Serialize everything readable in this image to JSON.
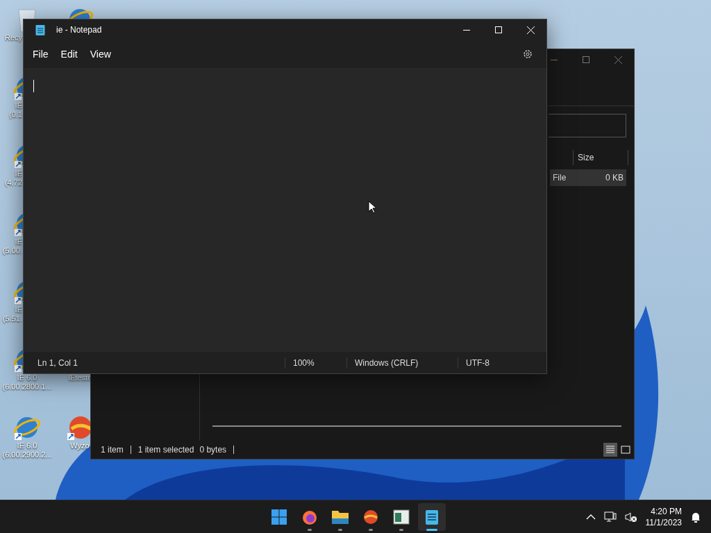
{
  "desktop": {
    "icons": [
      {
        "kind": "recycle",
        "lines": [
          "Recy"
        ]
      },
      {
        "kind": "ie",
        "lines": [
          "IE",
          "(0.1"
        ]
      },
      {
        "kind": "ie",
        "lines": [
          "IE",
          "(4.72"
        ]
      },
      {
        "kind": "ie",
        "lines": [
          "IE",
          "(5.00."
        ]
      },
      {
        "kind": "ie",
        "lines": [
          "IE",
          "(5.51."
        ]
      },
      {
        "kind": "ie",
        "lines": [
          "IE 6.0",
          "(6.00.2800.1..."
        ]
      },
      {
        "kind": "ie",
        "lines": [
          "IE 6.0",
          "(6.00.2900.2..."
        ]
      }
    ],
    "icons_right": [
      {
        "kind": "ie"
      },
      {
        "kind": "tester",
        "lines": [
          "IEteste"
        ]
      },
      {
        "kind": "wyzo",
        "lines": [
          "Wyzo"
        ]
      }
    ]
  },
  "explorer": {
    "column_header": "Size",
    "row": {
      "type": "File",
      "size": "0 KB",
      "selected": true
    },
    "status_items": "1 item",
    "status_selected": "1 item selected",
    "status_size": "0 bytes",
    "views": [
      {
        "kind": "details",
        "selected": true
      },
      {
        "kind": "tiles",
        "selected": false
      }
    ]
  },
  "notepad": {
    "title": "ie - Notepad",
    "menu": [
      "File",
      "Edit",
      "View"
    ],
    "status": {
      "position": "Ln 1, Col 1",
      "zoom": "100%",
      "line_ending": "Windows (CRLF)",
      "encoding": "UTF-8"
    }
  },
  "taskbar": {
    "apps": [
      {
        "kind": "start",
        "running": false,
        "selected": false
      },
      {
        "kind": "firefox",
        "running": true,
        "selected": false
      },
      {
        "kind": "folder",
        "running": true,
        "selected": false
      },
      {
        "kind": "wyzo",
        "running": true,
        "selected": false
      },
      {
        "kind": "window",
        "running": true,
        "selected": false
      },
      {
        "kind": "notepad",
        "running": true,
        "selected": true
      }
    ],
    "volume_muted": true,
    "time": "4:20 PM",
    "date": "11/1/2023"
  }
}
